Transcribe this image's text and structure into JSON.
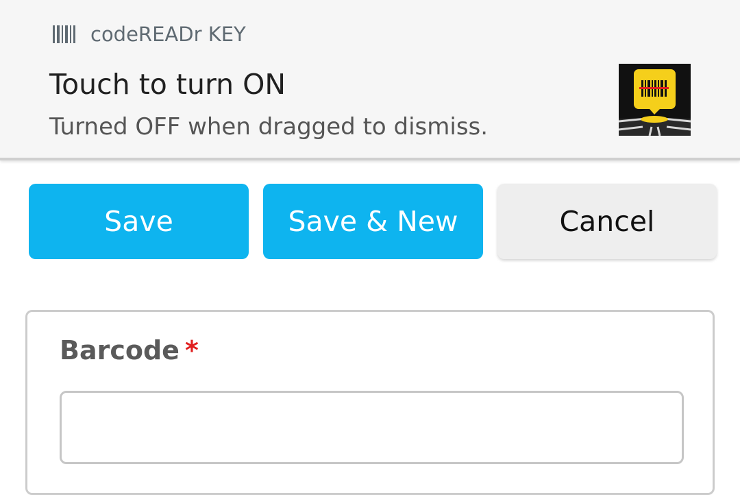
{
  "notification": {
    "app_name": "codeREADr KEY",
    "app_icon": "barcode-icon",
    "title": "Touch to turn ON",
    "text": "Turned OFF when dragged to dismiss.",
    "large_icon": "codereadr-key-icon"
  },
  "actions": {
    "save_label": "Save",
    "save_new_label": "Save & New",
    "cancel_label": "Cancel"
  },
  "form": {
    "barcode": {
      "label": "Barcode",
      "required_mark": "*",
      "value": "",
      "placeholder": ""
    }
  },
  "colors": {
    "primary": "#0eb4ef",
    "required": "#e01f1f",
    "icon_yellow": "#f5cf1b"
  }
}
